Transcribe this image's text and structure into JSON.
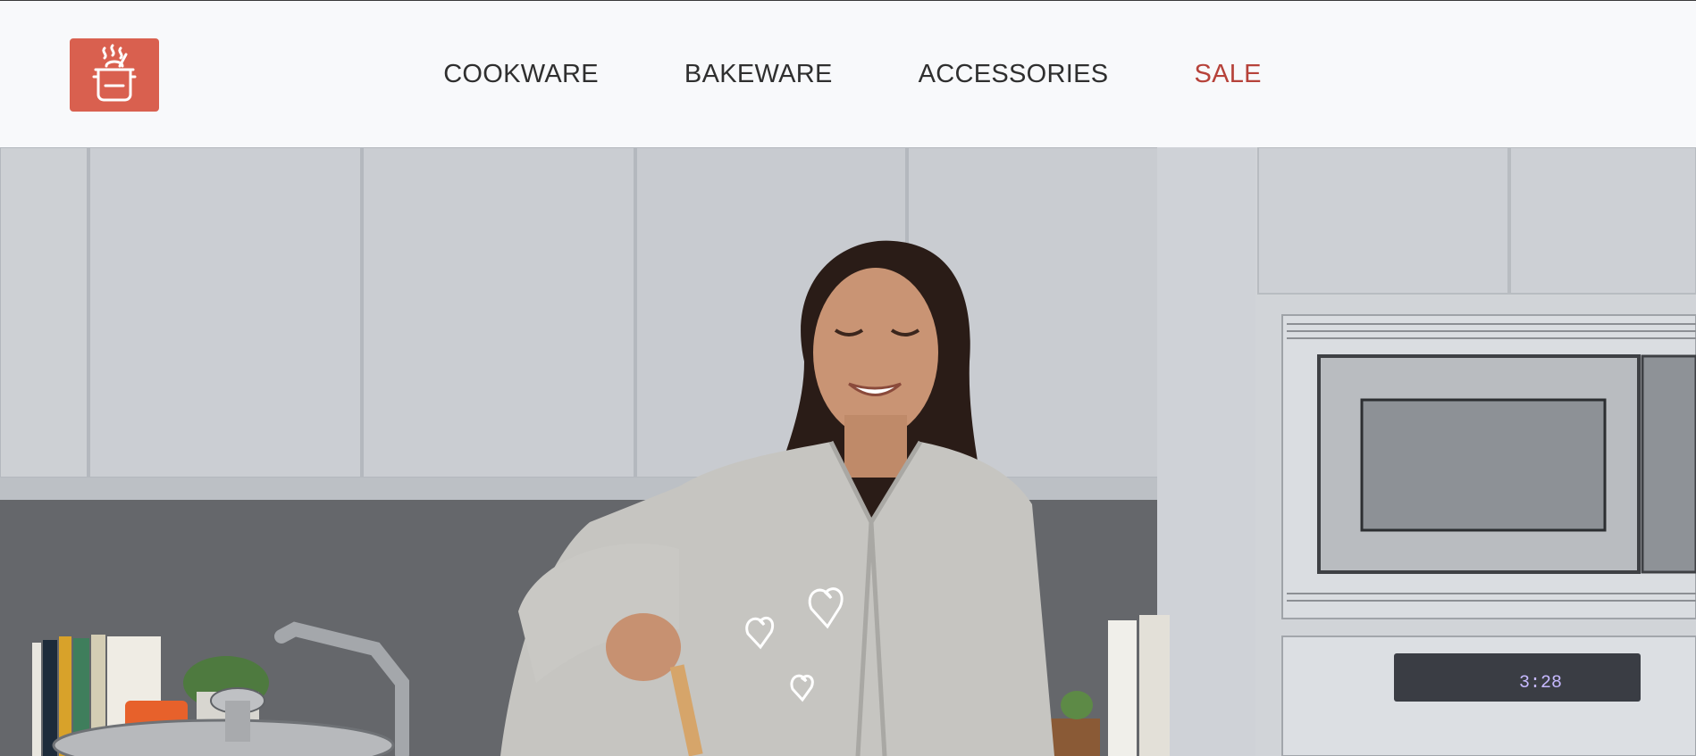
{
  "header": {
    "logo_icon": "cooking-pot-icon",
    "brand_color": "#d9604f",
    "nav": [
      {
        "label": "COOKWARE"
      },
      {
        "label": "BAKEWARE"
      },
      {
        "label": "ACCESSORIES"
      },
      {
        "label": "SALE",
        "accent": "#b6423a"
      }
    ]
  },
  "hero": {
    "image": "woman-cooking-in-kitchen-photo",
    "oven_display": "3:28"
  }
}
